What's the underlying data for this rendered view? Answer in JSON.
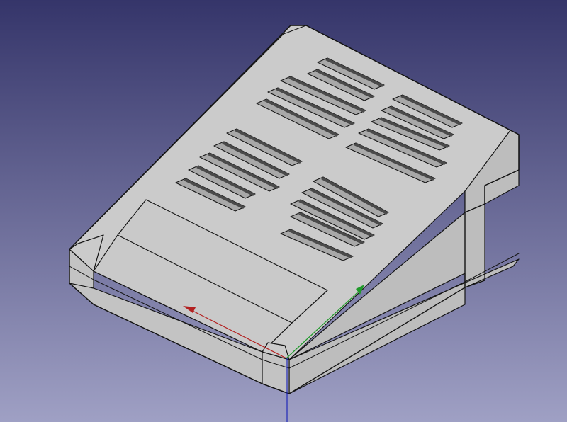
{
  "viewport": {
    "background_top": "#35356a",
    "background_bottom": "#9fa0c4"
  },
  "model": {
    "face_color": "#c9c9c9",
    "top_color": "#cbcbcb",
    "side_color": "#bdbdbd",
    "front_color": "#c3c3c3",
    "edge_color": "#141414",
    "slot_shadow": "#4a4a4a",
    "slot_floor": "#a8a8a8"
  },
  "axes": {
    "x_color": "#b32020",
    "y_color": "#1f9a2a",
    "z_color": "#2028b8"
  }
}
